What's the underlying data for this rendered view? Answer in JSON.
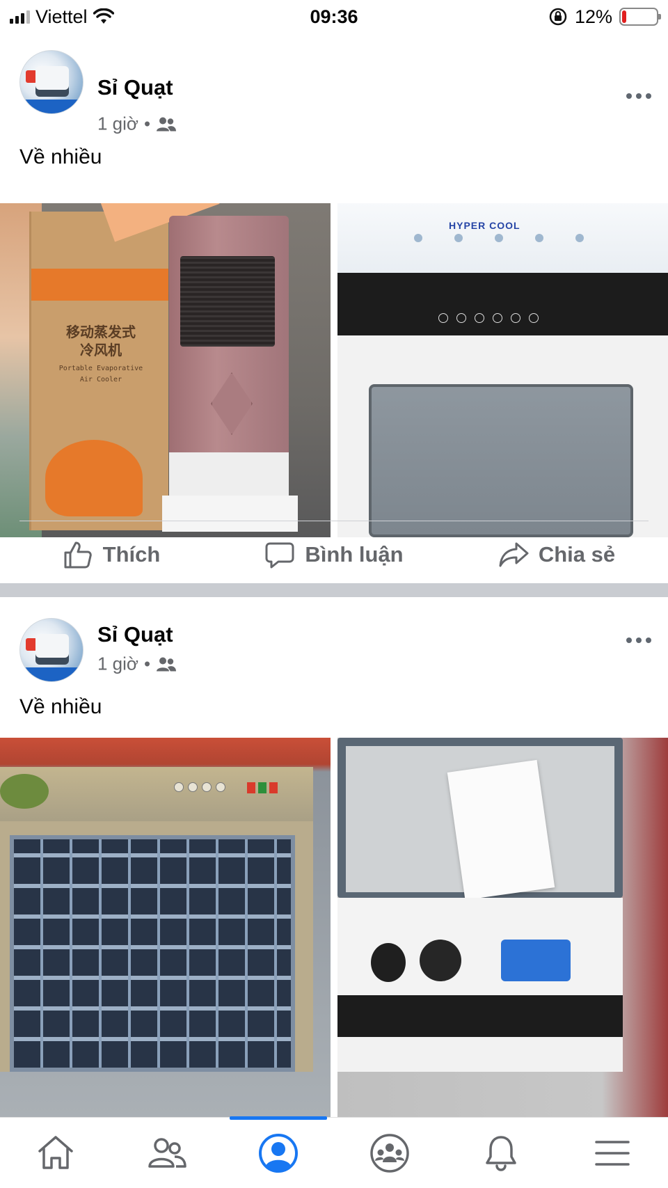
{
  "status_bar": {
    "carrier": "Viettel",
    "time": "09:36",
    "battery": "12%"
  },
  "posts": [
    {
      "author": "Sỉ Quạt",
      "time": "1 giờ",
      "separator": "•",
      "text": "Về nhiều",
      "box_label_cn": "移动蒸发式\n冷风机",
      "box_label_en": "Portable Evaporative\nAir Cooler",
      "brand_text": "HYPER COOL"
    },
    {
      "author": "Sỉ Quạt",
      "time": "1 giờ",
      "separator": "•",
      "text": "Về nhiều"
    }
  ],
  "actions": {
    "like": "Thích",
    "comment": "Bình luận",
    "share": "Chia sẻ"
  },
  "icons": {
    "audience": "friends-icon",
    "more": "more-icon",
    "like": "thumbs-up-icon",
    "comment": "comment-icon",
    "share": "share-icon"
  },
  "colors": {
    "accent": "#1877f2",
    "secondary_text": "#65676b",
    "battery_low": "#e02020"
  }
}
